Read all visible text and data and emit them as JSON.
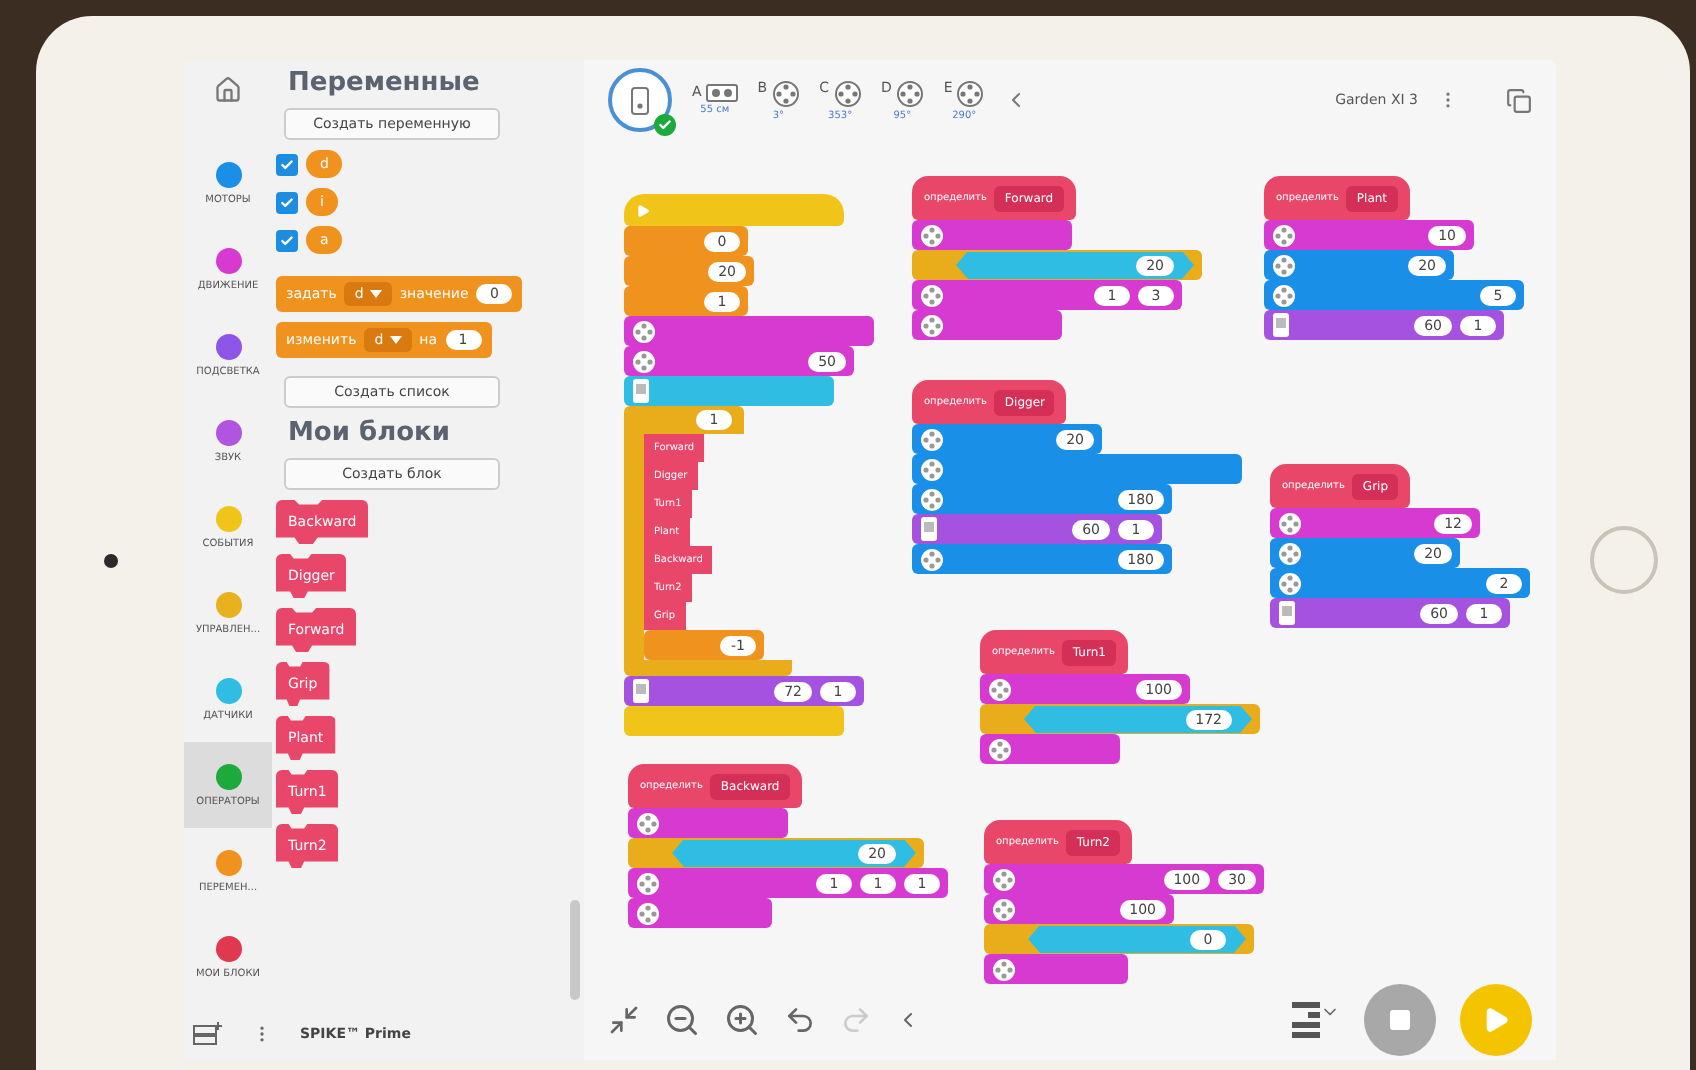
{
  "categories": [
    {
      "label": "МОТОРЫ",
      "color": "#1a8fe8",
      "selected": false
    },
    {
      "label": "ДВИЖЕНИЕ",
      "color": "#d63ad0",
      "selected": false
    },
    {
      "label": "ПОДСВЕТКА",
      "color": "#8e55e8",
      "selected": false
    },
    {
      "label": "ЗВУК",
      "color": "#b155e0",
      "selected": false
    },
    {
      "label": "СОБЫТИЯ",
      "color": "#f0c419",
      "selected": false
    },
    {
      "label": "УПРАВЛЕН...",
      "color": "#e8b21f",
      "selected": false
    },
    {
      "label": "ДАТЧИКИ",
      "color": "#30bde3",
      "selected": false
    },
    {
      "label": "ОПЕРАТОРЫ",
      "color": "#1daa3c",
      "selected": true
    },
    {
      "label": "ПЕРЕМЕН...",
      "color": "#f0921e",
      "selected": false
    },
    {
      "label": "МОИ БЛОКИ",
      "color": "#e0384e",
      "selected": false
    }
  ],
  "palette": {
    "variables_title": "Переменные",
    "create_variable_button": "Создать переменную",
    "variables": [
      {
        "name": "d",
        "checked": true
      },
      {
        "name": "i",
        "checked": true
      },
      {
        "name": "a",
        "checked": true
      }
    ],
    "set_block": {
      "label": "задать",
      "variable": "d",
      "word": "значение",
      "value": "0"
    },
    "change_block": {
      "label": "изменить",
      "variable": "d",
      "word": "на",
      "value": "1"
    },
    "create_list_button": "Создать список",
    "my_blocks_title": "Мои блоки",
    "create_block_button": "Создать блок",
    "my_blocks": [
      "Backward",
      "Digger",
      "Forward",
      "Grip",
      "Plant",
      "Turn1",
      "Turn2"
    ]
  },
  "topbar": {
    "ports": [
      {
        "letter": "A",
        "reading": "55 см"
      },
      {
        "letter": "B",
        "reading": "3°"
      },
      {
        "letter": "C",
        "reading": "353°"
      },
      {
        "letter": "D",
        "reading": "95°"
      },
      {
        "letter": "E",
        "reading": "290°"
      }
    ],
    "hub_connected": true,
    "hub_name": "Garden XI 3"
  },
  "footer": {
    "project": "SPIKE™ Prime"
  },
  "stacks": [
    {
      "kind": "start",
      "blocks": [
        {
          "kind": "plain",
          "color": "#f0921e",
          "values": [
            "0"
          ]
        },
        {
          "kind": "plain",
          "color": "#f0921e",
          "values": [
            "20"
          ]
        },
        {
          "kind": "plain",
          "color": "#f0921e",
          "values": [
            "1"
          ]
        },
        {
          "kind": "wheel",
          "color": "#d63ad0"
        },
        {
          "kind": "wheel",
          "color": "#d63ad0",
          "values": [
            "50"
          ]
        },
        {
          "kind": "hub",
          "color": "#30bde3"
        },
        {
          "kind": "loop",
          "color": "#e9ad1c",
          "values": [
            "1"
          ],
          "calls": [
            "Forward",
            "Digger",
            "Turn1",
            "Plant",
            "Backward",
            "Turn2",
            "Grip"
          ],
          "after": {
            "color": "#f0921e",
            "values": [
              "-1"
            ]
          }
        },
        {
          "kind": "hub",
          "color": "#a552e0",
          "values": [
            "72",
            "1"
          ]
        },
        {
          "kind": "plain",
          "color": "#f0c419"
        }
      ]
    },
    {
      "kind": "define",
      "label": "определить",
      "name": "Forward",
      "blocks": [
        {
          "kind": "wheel",
          "color": "#d63ad0"
        },
        {
          "kind": "hex",
          "color": "#e9ad1c",
          "values": [
            "20"
          ]
        },
        {
          "kind": "wheel",
          "color": "#d63ad0",
          "values": [
            "1",
            "3"
          ]
        },
        {
          "kind": "wheel",
          "color": "#d63ad0"
        }
      ]
    },
    {
      "kind": "define",
      "label": "определить",
      "name": "Digger",
      "blocks": [
        {
          "kind": "wheel",
          "color": "#1a8fe8",
          "values": [
            "20"
          ]
        },
        {
          "kind": "wheel",
          "color": "#1a8fe8"
        },
        {
          "kind": "wheel",
          "color": "#1a8fe8",
          "values": [
            "180"
          ]
        },
        {
          "kind": "hub",
          "color": "#a552e0",
          "values": [
            "60",
            "1"
          ]
        },
        {
          "kind": "wheel",
          "color": "#1a8fe8",
          "values": [
            "180"
          ]
        }
      ]
    },
    {
      "kind": "define",
      "label": "определить",
      "name": "Plant",
      "blocks": [
        {
          "kind": "wheel",
          "color": "#d63ad0",
          "values": [
            "10"
          ]
        },
        {
          "kind": "wheel",
          "color": "#1a8fe8",
          "values": [
            "20"
          ]
        },
        {
          "kind": "wheel",
          "color": "#1a8fe8",
          "values": [
            "5"
          ]
        },
        {
          "kind": "hub",
          "color": "#a552e0",
          "values": [
            "60",
            "1"
          ]
        }
      ]
    },
    {
      "kind": "define",
      "label": "определить",
      "name": "Grip",
      "blocks": [
        {
          "kind": "wheel",
          "color": "#d63ad0",
          "values": [
            "12"
          ]
        },
        {
          "kind": "wheel",
          "color": "#1a8fe8",
          "values": [
            "20"
          ]
        },
        {
          "kind": "wheel",
          "color": "#1a8fe8",
          "values": [
            "2"
          ]
        },
        {
          "kind": "hub",
          "color": "#a552e0",
          "values": [
            "60",
            "1"
          ]
        }
      ]
    },
    {
      "kind": "define",
      "label": "определить",
      "name": "Turn1",
      "blocks": [
        {
          "kind": "wheel",
          "color": "#d63ad0",
          "values": [
            "100"
          ]
        },
        {
          "kind": "hex",
          "color": "#e9ad1c",
          "values": [
            "172"
          ]
        },
        {
          "kind": "wheel",
          "color": "#d63ad0"
        }
      ]
    },
    {
      "kind": "define",
      "label": "определить",
      "name": "Backward",
      "blocks": [
        {
          "kind": "wheel",
          "color": "#d63ad0"
        },
        {
          "kind": "hex",
          "color": "#e9ad1c",
          "values": [
            "20"
          ]
        },
        {
          "kind": "wheel",
          "color": "#d63ad0",
          "values": [
            "1",
            "1",
            "1"
          ]
        },
        {
          "kind": "wheel",
          "color": "#d63ad0"
        }
      ]
    },
    {
      "kind": "define",
      "label": "определить",
      "name": "Turn2",
      "blocks": [
        {
          "kind": "wheel",
          "color": "#d63ad0",
          "values": [
            "100",
            "30"
          ]
        },
        {
          "kind": "wheel",
          "color": "#d63ad0",
          "values": [
            "100"
          ]
        },
        {
          "kind": "hex",
          "color": "#e9ad1c",
          "values": [
            "0"
          ]
        },
        {
          "kind": "wheel",
          "color": "#d63ad0"
        }
      ]
    }
  ]
}
